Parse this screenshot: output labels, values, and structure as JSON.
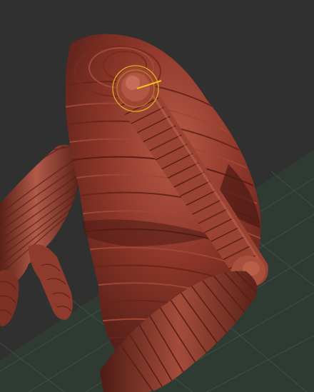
{
  "viewport": {
    "background_color": "#303030",
    "floor_grid_color": "#2f3d33",
    "floor_line_color": "#3f5446",
    "mesh_base_color": "#8a3428",
    "mesh_shadow_color": "#4a1c16",
    "mesh_highlight_color": "#b35a47",
    "brush_cursor_color": "#e0b020"
  },
  "icons": {
    "brush_cursor": "circle-brush-cursor-icon",
    "stroke_direction": "stroke-direction-line-icon"
  }
}
